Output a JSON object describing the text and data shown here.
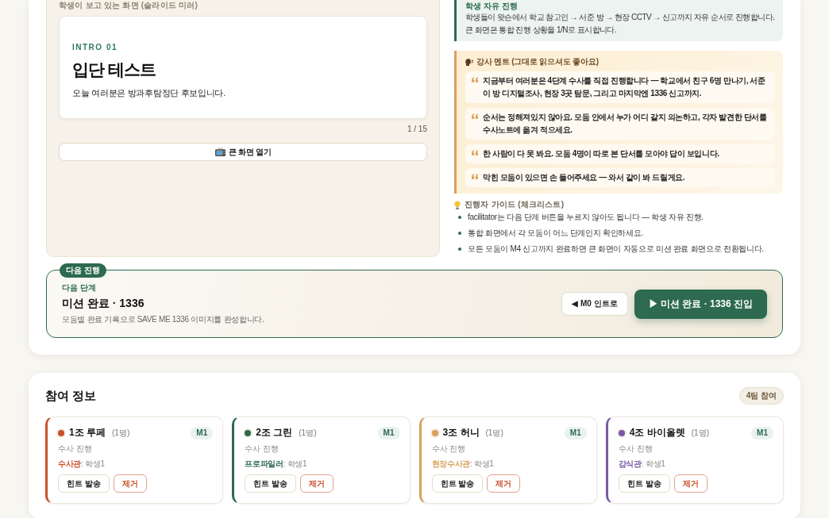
{
  "slide_preview": {
    "label": "학생이 보고 있는 화면 (슬라이드 미러)",
    "eyebrow": "INTRO 01",
    "title": "입단 테스트",
    "body": "오늘 여러분은 방과후탐정단 후보입니다.",
    "counter": "1 / 15",
    "open_button": "큰 화면 열기"
  },
  "mode_note": {
    "title": "학생 자유 진행",
    "lines": [
      "학생들이 왓슨에서 학교 참고인 → 서준 방 → 현장 CCTV → 신고까지 자유 순서로 진행합니다.",
      "큰 화면은 통합 진행 상황을 1/N로 표시합니다."
    ]
  },
  "script": {
    "title": "강사 멘트 (그대로 읽으셔도 좋아요)",
    "quotes": [
      "지금부터 여러분은 4단계 수사를 직접 진행합니다 — 학교에서 친구 6명 만나기, 서준이 방 디지털조사, 현장 3곳 탐문, 그리고 마지막엔 1336 신고까지.",
      "순서는 정해져있지 않아요. 모둠 안에서 누가 어디 갈지 의논하고, 각자 발견한 단서를 수사노트에 옮겨 적으세요.",
      "한 사람이 다 못 봐요. 모둠 4명이 따로 본 단서를 모아야 답이 보입니다.",
      "막힌 모둠이 있으면 손 들어주세요 — 와서 같이 봐 드릴게요."
    ]
  },
  "guide": {
    "title": "진행자 가이드 (체크리스트)",
    "items": [
      "facilitator는 다음 단계 버튼을 누르지 않아도 됩니다 — 학생 자유 진행.",
      "통합 화면에서 각 모둠이 어느 단계인지 확인하세요.",
      "모든 모둠이 M4 신고까지 완료하면 큰 화면이 자동으로 미션 완료 화면으로 전환됩니다."
    ]
  },
  "next_step": {
    "badge": "다음 진행",
    "label": "다음 단계",
    "title": "미션 완료 · 1336",
    "description": "모둠별 완료 기록으로 SAVE ME 1336 이미지를 완성합니다.",
    "buttons": [
      {
        "label": "◀ M0 인트로",
        "kind": "secondary"
      },
      {
        "label": "▶ 미션 완료 · 1336 진입",
        "kind": "primary"
      }
    ]
  },
  "participants": {
    "title": "참여 정보",
    "count_badge": "4팀 참여",
    "teams": [
      {
        "name": "1조 루페",
        "members": "(1명)",
        "stage": "M1",
        "status": "수사 진행",
        "role_line": "**수사관**: 학생1",
        "color": "#c9512b",
        "actions": [
          {
            "label": "힌트 발송",
            "kind": "default"
          },
          {
            "label": "제거",
            "kind": "danger"
          }
        ]
      },
      {
        "name": "2조 그린",
        "members": "(1명)",
        "stage": "M1",
        "status": "수사 진행",
        "role_line": "**프로파일러**: 학생1",
        "color": "#2d6a4f",
        "actions": [
          {
            "label": "힌트 발송",
            "kind": "default"
          },
          {
            "label": "제거",
            "kind": "danger"
          }
        ]
      },
      {
        "name": "3조 허니",
        "members": "(1명)",
        "stage": "M1",
        "status": "수사 진행",
        "role_line": "**현장수사관**: 학생1",
        "color": "#d6a25a",
        "actions": [
          {
            "label": "힌트 발송",
            "kind": "default"
          },
          {
            "label": "제거",
            "kind": "danger"
          }
        ]
      },
      {
        "name": "4조 바이올렛",
        "members": "(1명)",
        "stage": "M1",
        "status": "수사 진행",
        "role_line": "**감식관**: 학생1",
        "color": "#7b58a6",
        "actions": [
          {
            "label": "힌트 발송",
            "kind": "default"
          },
          {
            "label": "제거",
            "kind": "danger"
          }
        ]
      }
    ]
  }
}
